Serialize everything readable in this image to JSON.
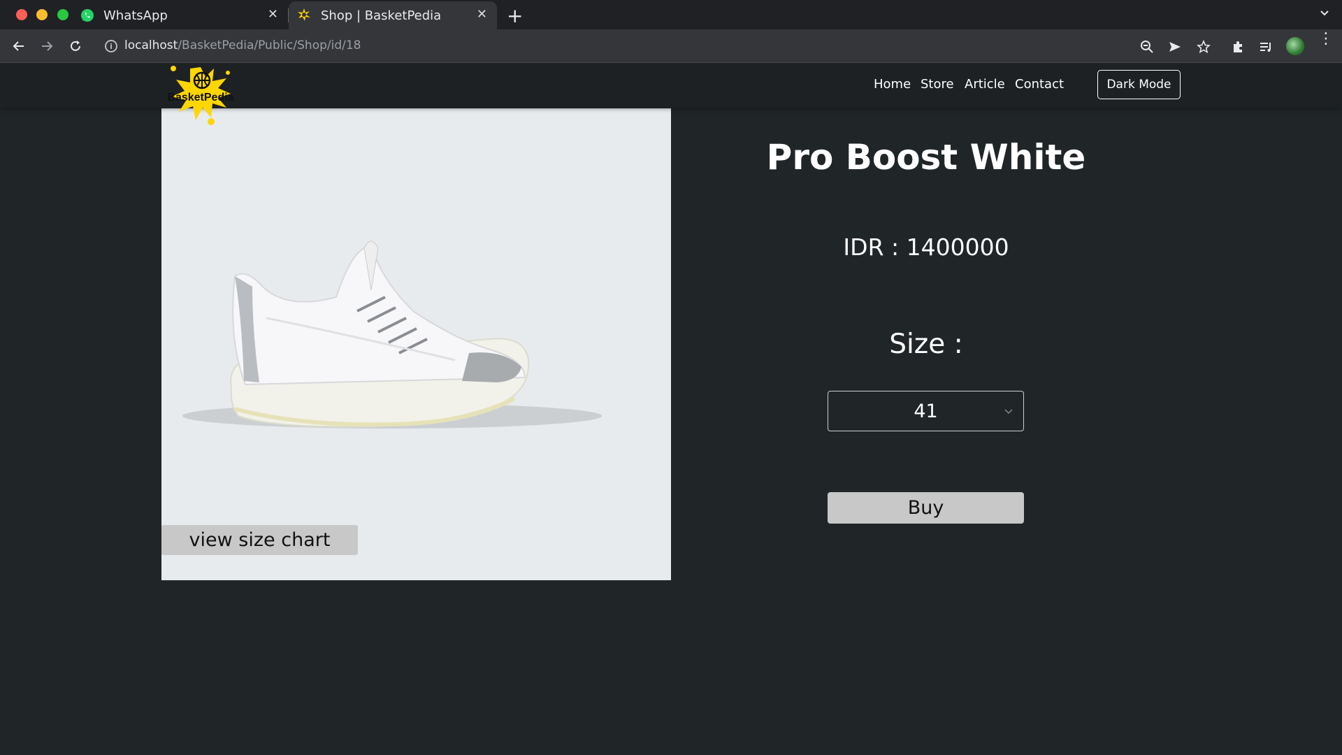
{
  "browser": {
    "tabs": [
      {
        "title": "WhatsApp",
        "active": false
      },
      {
        "title": "Shop | BasketPedia",
        "active": true
      }
    ],
    "url_host": "localhost",
    "url_path": "/BasketPedia/Public/Shop/id/18",
    "icons": [
      "back-arrow-icon",
      "forward-arrow-icon",
      "reload-icon",
      "info-icon",
      "zoom-icon",
      "send-icon",
      "star-icon",
      "extensions-icon",
      "reading-list-icon",
      "profile-avatar",
      "menu-kebab-icon"
    ]
  },
  "site": {
    "logo_text": "BasketPedia",
    "nav": [
      "Home",
      "Store",
      "Article",
      "Contact"
    ],
    "dark_mode_label": "Dark Mode",
    "colors": {
      "background": "#202528",
      "header": "#1d2124",
      "accent": "#ffd600",
      "button": "#c8c8c8"
    }
  },
  "product": {
    "title": "Pro Boost White",
    "price": "IDR : 1400000",
    "size_label": "Size :",
    "selected_size": "41",
    "buy_label": "Buy",
    "size_chart_label": "view size chart"
  }
}
